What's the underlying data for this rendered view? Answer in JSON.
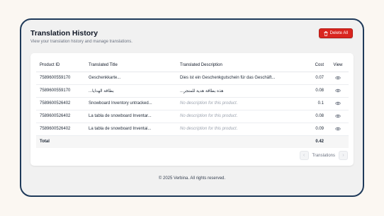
{
  "header": {
    "title": "Translation History",
    "subtitle": "View your translation history and manage translations.",
    "delete_all_label": "Delete All"
  },
  "colors": {
    "accent_danger": "#d9251f",
    "frame_border": "#1f3a5a"
  },
  "table": {
    "columns": {
      "product_id": "Product ID",
      "translated_title": "Translated Title",
      "translated_description": "Translated Description",
      "cost": "Cost",
      "view": "View"
    },
    "rows": [
      {
        "product_id": "7589600559170",
        "title": "Geschenkkarte...",
        "description": "Dies ist ein Geschenkgutschein für das Geschäft...",
        "has_description": true,
        "cost": "0.07"
      },
      {
        "product_id": "7589600559170",
        "title": "بطاقة الهدايا...",
        "description": "هذه بطاقة هدية للمتجر...",
        "has_description": true,
        "cost": "0.08"
      },
      {
        "product_id": "7589600526402",
        "title": "Snowboard Inventory untracked...",
        "description": "No description for this product.",
        "has_description": false,
        "cost": "0.1"
      },
      {
        "product_id": "7589600526402",
        "title": "La tabla de snowboard Inventar...",
        "description": "No description for this product.",
        "has_description": false,
        "cost": "0.08"
      },
      {
        "product_id": "7589600526402",
        "title": "La tabla de snowboard Inventai...",
        "description": "No description for this product.",
        "has_description": false,
        "cost": "0.09"
      }
    ],
    "total_label": "Total",
    "total_value": "0.42"
  },
  "pagination": {
    "label": "Translations",
    "prev_icon": "chevron-left-icon",
    "next_icon": "chevron-right-icon"
  },
  "footer": {
    "text": "© 2025 Verbina. All rights reserved."
  }
}
